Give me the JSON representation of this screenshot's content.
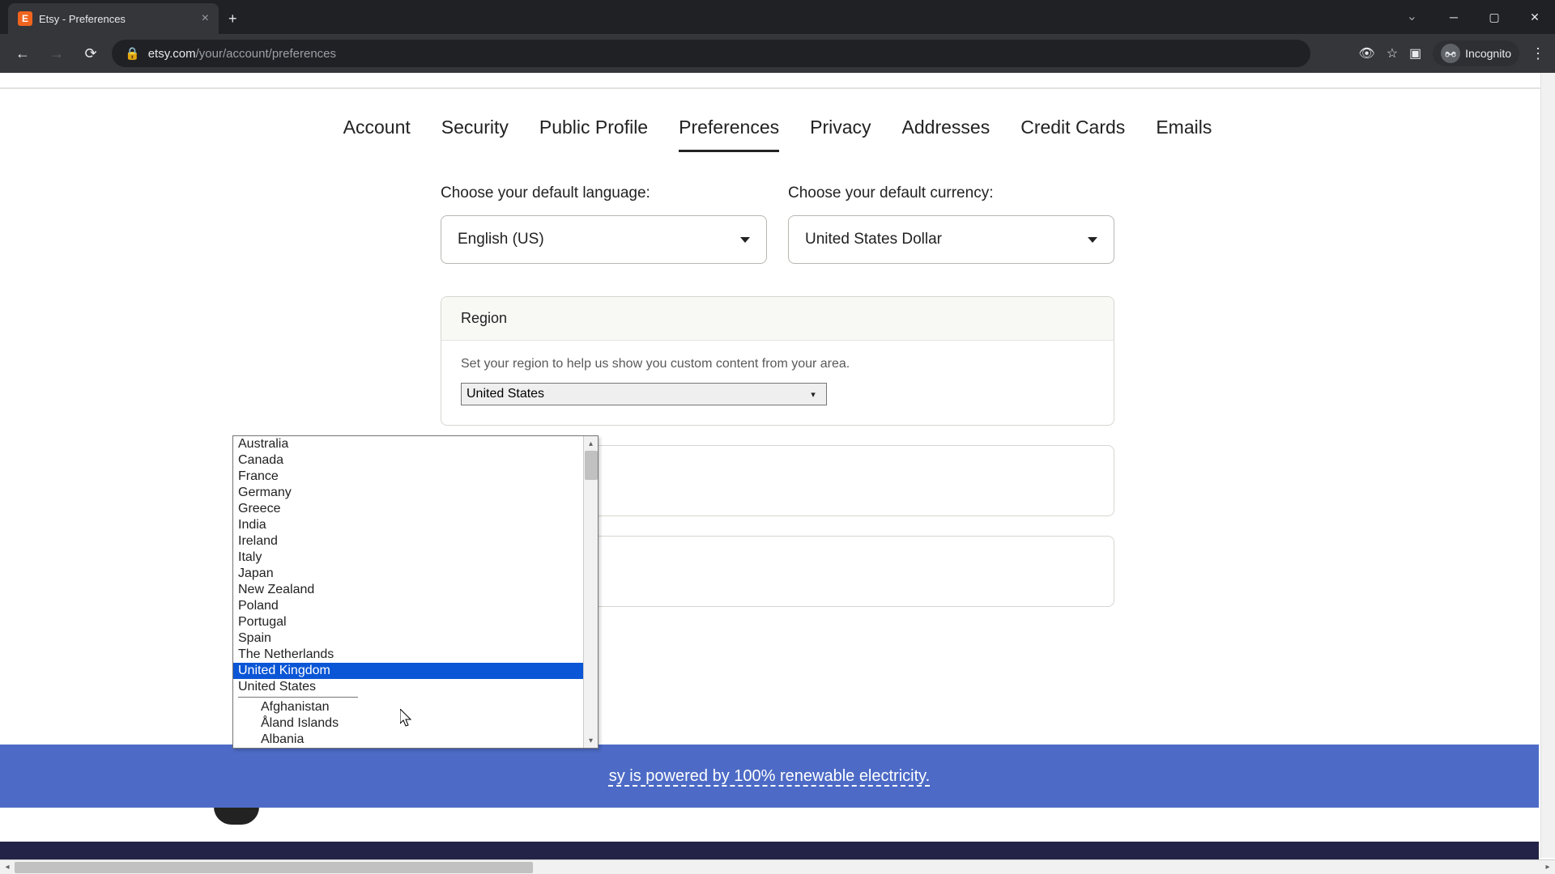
{
  "browser": {
    "tab_title": "Etsy - Preferences",
    "url_domain": "etsy.com",
    "url_path": "/your/account/preferences",
    "incognito_label": "Incognito"
  },
  "nav_tabs": {
    "items": [
      {
        "label": "Account"
      },
      {
        "label": "Security"
      },
      {
        "label": "Public Profile"
      },
      {
        "label": "Preferences"
      },
      {
        "label": "Privacy"
      },
      {
        "label": "Addresses"
      },
      {
        "label": "Credit Cards"
      },
      {
        "label": "Emails"
      }
    ],
    "active_index": 3
  },
  "language": {
    "label": "Choose your default language:",
    "value": "English (US)"
  },
  "currency": {
    "label": "Choose your default currency:",
    "value": "United States Dollar"
  },
  "region": {
    "header": "Region",
    "description": "Set your region to help us show you custom content from your area.",
    "selected": "United States",
    "options_primary": [
      "Australia",
      "Canada",
      "France",
      "Germany",
      "Greece",
      "India",
      "Ireland",
      "Italy",
      "Japan",
      "New Zealand",
      "Poland",
      "Portugal",
      "Spain",
      "The Netherlands",
      "United Kingdom",
      "United States"
    ],
    "options_secondary": [
      "Afghanistan",
      "Åland Islands",
      "Albania"
    ],
    "highlighted": "United Kingdom"
  },
  "footer": {
    "text_suffix": "sy is powered by 100% renewable electricity."
  }
}
